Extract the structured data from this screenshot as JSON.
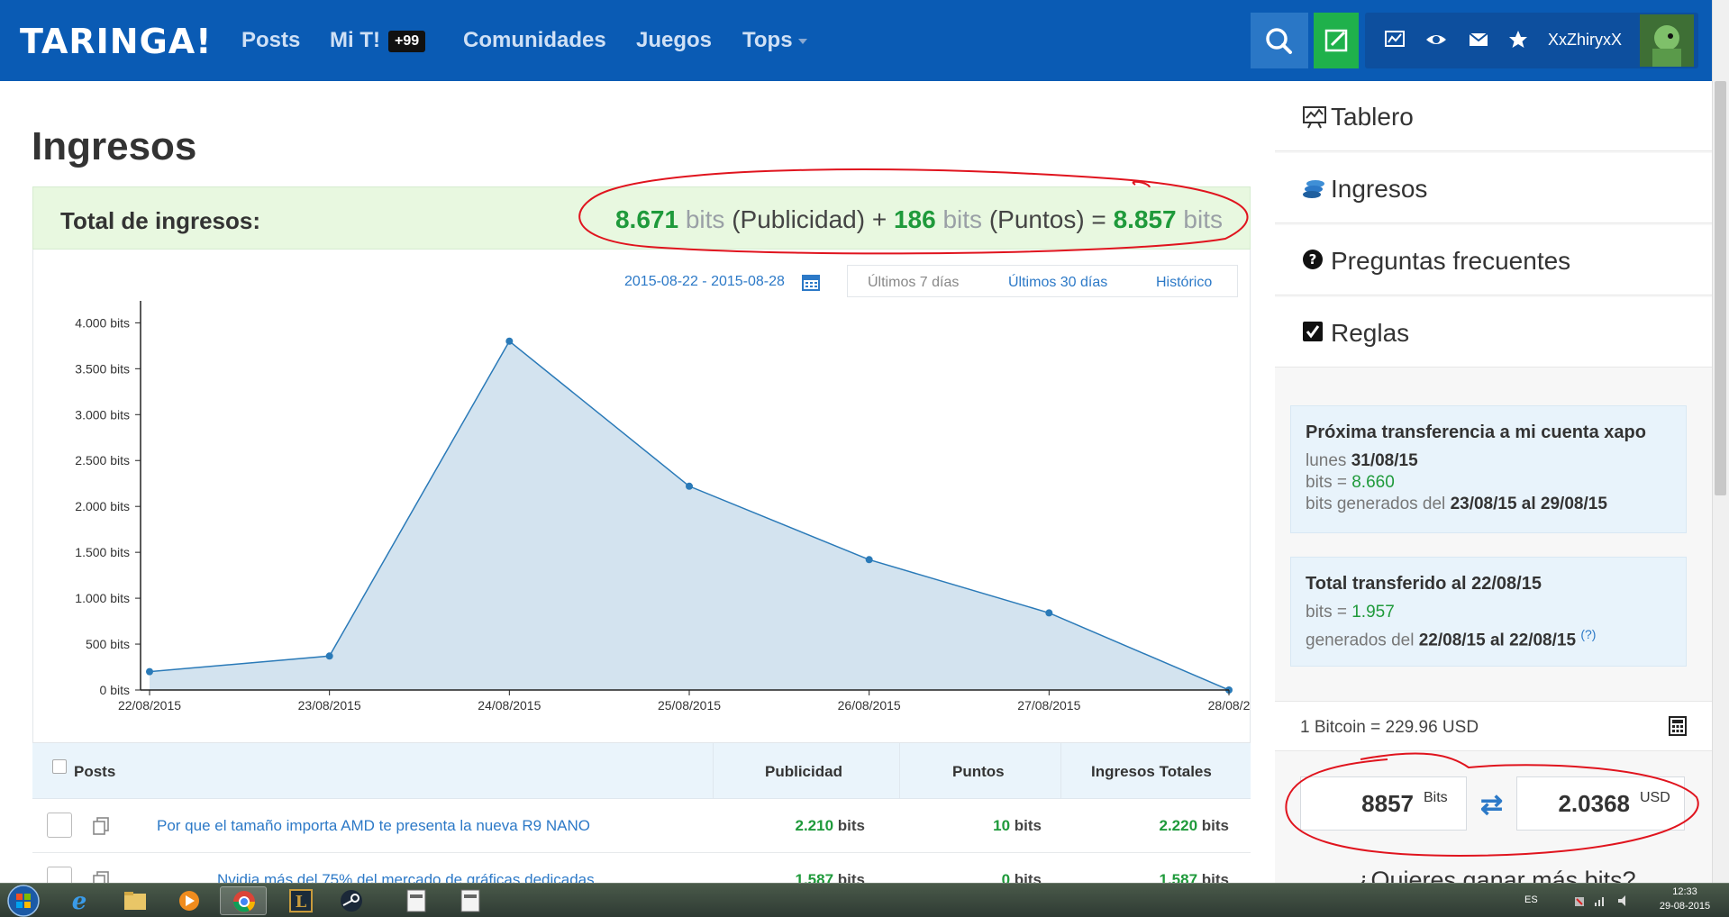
{
  "nav": {
    "logo": "TARINGA!",
    "posts": "Posts",
    "mi_t": "Mi T!",
    "mi_t_badge": "+99",
    "comunidades": "Comunidades",
    "juegos": "Juegos",
    "tops": "Tops",
    "username": "XxZhiryxX"
  },
  "page": {
    "title": "Ingresos",
    "total_label": "Total de ingresos:",
    "total": {
      "publicidad_num": "8.671",
      "publicidad_unit": "bits",
      "publicidad_label": "(Publicidad) +",
      "puntos_num": "186",
      "puntos_unit": "bits",
      "puntos_label": "(Puntos) =",
      "total_num": "8.857",
      "total_unit": "bits"
    },
    "date_range": "2015-08-22 - 2015-08-28",
    "range_tabs": [
      "Últimos 7 días",
      "Últimos 30 días",
      "Histórico"
    ]
  },
  "chart_data": {
    "type": "area",
    "title": "",
    "xlabel": "",
    "ylabel": "",
    "categories": [
      "22/08/2015",
      "23/08/2015",
      "24/08/2015",
      "25/08/2015",
      "26/08/2015",
      "27/08/2015",
      "28/08/2"
    ],
    "series": [
      {
        "values": [
          200,
          370,
          3800,
          2220,
          1420,
          840,
          0
        ]
      }
    ],
    "ylim": [
      0,
      4200
    ],
    "yticks": [
      0,
      500,
      1000,
      1500,
      2000,
      2500,
      3000,
      3500,
      4000
    ],
    "ytick_labels": [
      "0 bits",
      "500 bits",
      "1.000 bits",
      "1.500 bits",
      "2.000 bits",
      "2.500 bits",
      "3.000 bits",
      "3.500 bits",
      "4.000 bits"
    ],
    "grid": false,
    "colors": {
      "line": "#2a7ab8",
      "fill": "#d3e3ef"
    }
  },
  "table": {
    "headers": {
      "posts": "Posts",
      "publicidad": "Publicidad",
      "puntos": "Puntos",
      "totales": "Ingresos Totales"
    },
    "rows": [
      {
        "title": "Por que el tamaño importa AMD te presenta la nueva R9 NANO",
        "publicidad_num": "2.210",
        "puntos_num": "10",
        "total_num": "2.220",
        "unit": "bits"
      },
      {
        "title": "Nvidia más del 75% del mercado de gráficas dedicadas",
        "publicidad_num": "1.587",
        "puntos_num": "0",
        "total_num": "1.587",
        "unit": "bits"
      }
    ]
  },
  "sidebar": {
    "items": [
      "Tablero",
      "Ingresos",
      "Preguntas frecuentes",
      "Reglas"
    ],
    "next_transfer": {
      "title": "Próxima transferencia a mi cuenta xapo",
      "day_prefix": "lunes",
      "day": "31/08/15",
      "bits_prefix": "bits =",
      "bits": "8.660",
      "generated_prefix": "bits generados del",
      "generated_range": "23/08/15 al 29/08/15"
    },
    "transferred": {
      "title": "Total transferido al 22/08/15",
      "bits_prefix": "bits =",
      "bits": "1.957",
      "generated_prefix": "generados del",
      "generated_range": "22/08/15 al 22/08/15",
      "help": "(?)"
    },
    "rate": "1 Bitcoin = 229.96 USD",
    "converter": {
      "bits": "8857",
      "bits_unit": "Bits",
      "usd": "2.0368",
      "usd_unit": "USD"
    },
    "teaser": "¿Quieres ganar más bits?"
  },
  "taskbar": {
    "lang": "ES",
    "time": "12:33",
    "date": "29-08-2015"
  },
  "colors": {
    "brand": "#0a5bb4",
    "green": "#1f9a3b",
    "link": "#2c79c7",
    "annotation": "#e0141e"
  }
}
